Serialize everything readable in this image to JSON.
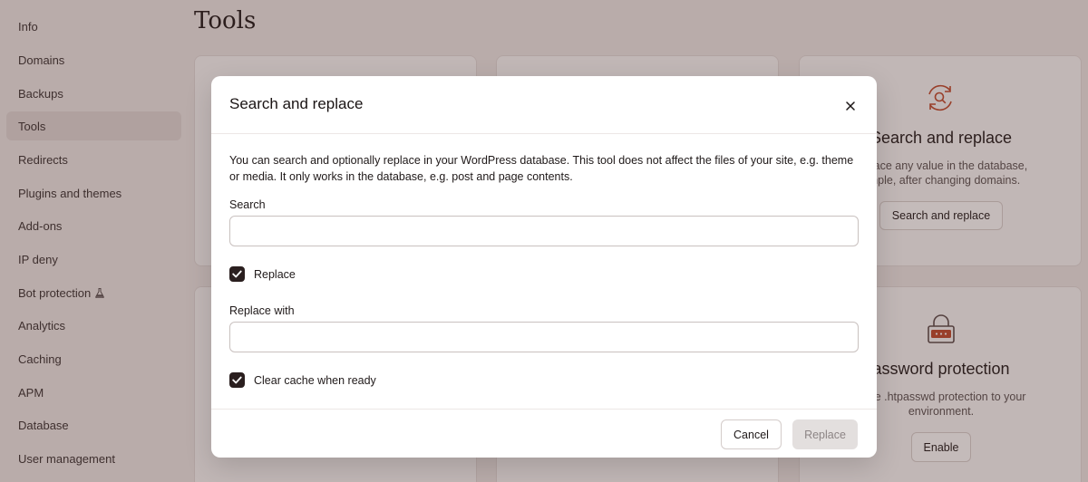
{
  "sidebar": {
    "items": [
      {
        "label": "Info"
      },
      {
        "label": "Domains"
      },
      {
        "label": "Backups"
      },
      {
        "label": "Tools"
      },
      {
        "label": "Redirects"
      },
      {
        "label": "Plugins and themes"
      },
      {
        "label": "Add-ons"
      },
      {
        "label": "IP deny"
      },
      {
        "label": "Bot protection"
      },
      {
        "label": "Analytics"
      },
      {
        "label": "Caching"
      },
      {
        "label": "APM"
      },
      {
        "label": "Database"
      },
      {
        "label": "User management"
      }
    ],
    "active": "Tools"
  },
  "page": {
    "title": "Tools"
  },
  "cards": {
    "search_replace": {
      "title": "Search and replace",
      "desc_line1": "replace any value in the database,",
      "desc_line2": "ample, after changing domains.",
      "button": "Search and replace"
    },
    "password": {
      "title": "assword protection",
      "desc_line1": "mple .htpasswd protection to your",
      "desc_line2": "environment.",
      "button": "Enable"
    }
  },
  "modal": {
    "title": "Search and replace",
    "description": "You can search and optionally replace in your WordPress database. This tool does not affect the files of your site, e.g. theme or media. It only works in the database, e.g. post and page contents.",
    "search_label": "Search",
    "search_value": "",
    "replace_checkbox_label": "Replace",
    "replace_checked": true,
    "replace_with_label": "Replace with",
    "replace_with_value": "",
    "clear_cache_label": "Clear cache when ready",
    "clear_cache_checked": true,
    "cancel_label": "Cancel",
    "replace_button_label": "Replace"
  },
  "colors": {
    "accent": "#c0492b",
    "checkbox": "#2a1f1f",
    "overlay": "#462d28"
  }
}
